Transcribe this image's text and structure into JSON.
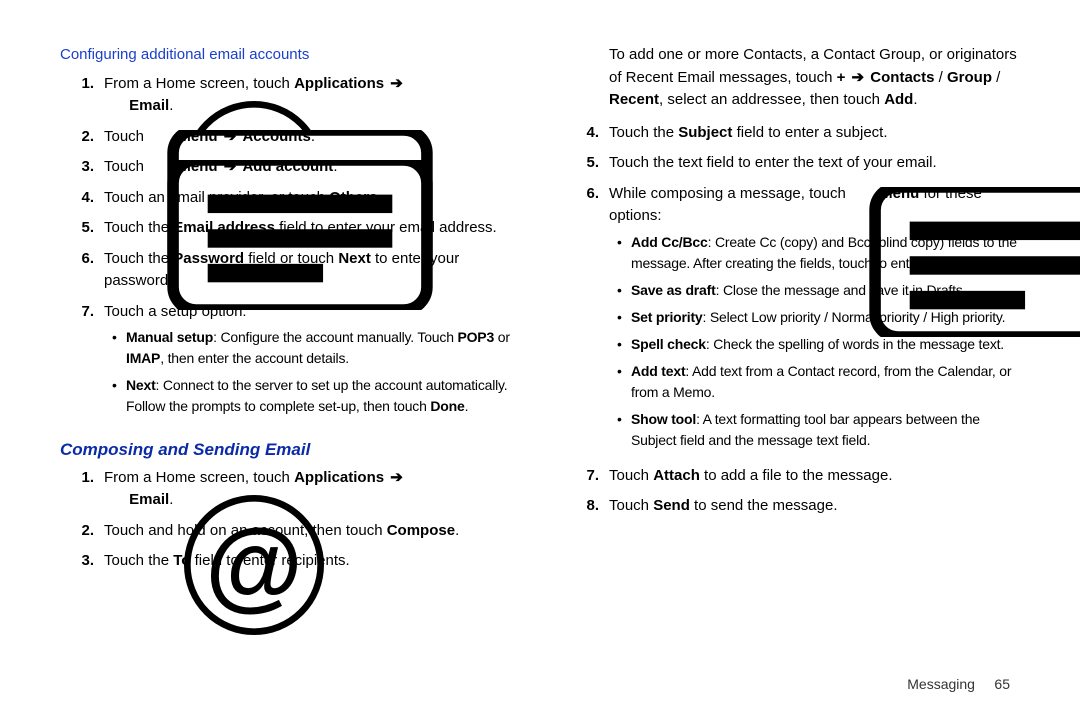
{
  "footer": {
    "section": "Messaging",
    "page": "65"
  },
  "left": {
    "heading": "Configuring additional email accounts",
    "items": [
      {
        "n": "1.",
        "before": "From a Home screen, touch ",
        "app": "Applications",
        "email": "Email",
        "after": "."
      },
      {
        "n": "2.",
        "before": "Touch ",
        "menu": "Menu",
        "arrow": "➔",
        "target": "Accounts",
        "after": "."
      },
      {
        "n": "3.",
        "before": "Touch ",
        "menu": "Menu",
        "arrow": "➔",
        "target": "Add account",
        "after": "."
      },
      {
        "n": "4.",
        "a": "Touch an email provider, or touch ",
        "b": "Others",
        "c": "."
      },
      {
        "n": "5.",
        "a": "Touch the ",
        "b": "Email address",
        "c": " field to enter your email address."
      },
      {
        "n": "6.",
        "a": "Touch the ",
        "b": "Password",
        "c": " field or touch ",
        "d": "Next",
        "e": " to enter your password."
      },
      {
        "n": "7.",
        "a": "Touch a setup option:"
      }
    ],
    "setup_bullets": [
      {
        "b1": "Manual setup",
        "m": ": Configure the account manually. Touch ",
        "b2": "POP3",
        "or": " or ",
        "b3": "IMAP",
        "tail": ", then enter the account details."
      },
      {
        "b1": "Next",
        "m": ": Connect to the server to set up the account automatically. Follow the prompts to complete set-up, then touch ",
        "b2": "Done",
        "tail": "."
      }
    ],
    "subhead": "Composing and Sending Email",
    "compose": [
      {
        "n": "1.",
        "before": "From a Home screen, touch ",
        "app": "Applications",
        "email": "Email",
        "after": "."
      },
      {
        "n": "2.",
        "a": "Touch and hold on an account, then touch ",
        "b": "Compose",
        "c": "."
      },
      {
        "n": "3.",
        "a": "Touch the ",
        "b": "To",
        "c": " field to enter recipients."
      }
    ]
  },
  "right": {
    "lead": {
      "l1": "To add one or more Contacts, a Contact Group, or originators of Recent Email messages, touch ",
      "plus": "+",
      "arrow": "➔",
      "b2": "Contacts",
      "s1": " / ",
      "b3": "Group",
      "s2": " / ",
      "b4": "Recent",
      "mid2": ", select an addressee, then touch ",
      "b5": "Add",
      "end": "."
    },
    "items_a": [
      {
        "n": "4.",
        "a": "Touch the ",
        "b": "Subject",
        "c": " field to enter a subject."
      },
      {
        "n": "5.",
        "a": "Touch the text field to enter the text of your email."
      },
      {
        "n": "6.",
        "a": "While composing a message, touch ",
        "menu": "Menu",
        "c": " for these options:"
      }
    ],
    "menu_bullets": [
      {
        "b": "Add Cc/Bcc",
        "t": ": Create Cc (copy) and Bcc (blind copy) fields to the message. After creating the fields, touch to enter recipients."
      },
      {
        "b": "Save as draft",
        "t": ": Close the message and save it in Drafts."
      },
      {
        "b": "Set priority",
        "t": ": Select Low priority / Normal priority / High priority."
      },
      {
        "b": "Spell check",
        "t": ": Check the spelling of words in the message text."
      },
      {
        "b": "Add text",
        "t": ": Add text from a Contact record, from the Calendar, or from a Memo."
      },
      {
        "b": "Show tool",
        "t": ": A text formatting tool bar appears between the Subject field and the message text field."
      }
    ],
    "items_b": [
      {
        "n": "7.",
        "a": "Touch ",
        "b": "Attach",
        "c": " to add a file to the message."
      },
      {
        "n": "8.",
        "a": "Touch ",
        "b": "Send",
        "c": " to send the message."
      }
    ]
  }
}
